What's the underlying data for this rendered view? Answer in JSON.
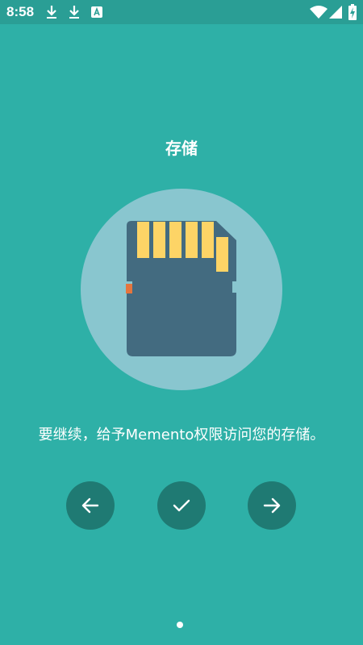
{
  "status_bar": {
    "time": "8:58",
    "icons": [
      "download-icon",
      "download-icon",
      "a-notification-icon",
      "wifi-icon",
      "cell-signal-icon",
      "battery-charging-icon"
    ]
  },
  "screen": {
    "title": "存储",
    "illustration": "sd-card-icon",
    "message": "要继续，给予Memento权限访问您的存储。"
  },
  "buttons": {
    "back": "arrow-left-icon",
    "confirm": "check-icon",
    "next": "arrow-right-icon"
  },
  "colors": {
    "background": "#2EB0A7",
    "status_bar": "#2A9E95",
    "button": "#1F7A73",
    "circle": "#89C6CF",
    "card": "#436B80",
    "contacts": "#FDD466",
    "notch_accent": "#E5753E"
  },
  "pager": {
    "pages": 1,
    "current": 1
  }
}
